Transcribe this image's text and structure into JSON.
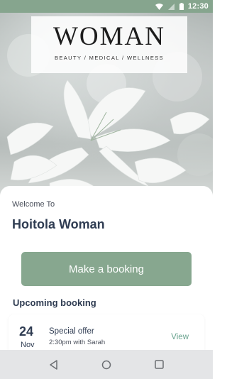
{
  "status_bar": {
    "time": "12:30",
    "icons": [
      "wifi-icon",
      "signal-icon",
      "battery-icon"
    ]
  },
  "hero": {
    "logo": {
      "word": "WOMAN",
      "tagline": "BEAUTY  /  MEDICAL  /  WELLNESS"
    }
  },
  "welcome": {
    "greeting": "Welcome To",
    "title": "Hoitola Woman"
  },
  "actions": {
    "booking_label": "Make a booking"
  },
  "upcoming": {
    "heading": "Upcoming booking",
    "items": [
      {
        "day": "24",
        "month": "Nov",
        "title": "Special offer",
        "details": "2:30pm with Sarah",
        "action": "View"
      }
    ]
  },
  "nav": {
    "buttons": [
      "back-icon",
      "home-icon",
      "recents-icon"
    ]
  },
  "colors": {
    "accent": "#87a78f",
    "status_bar": "#86a58e",
    "title_text": "#2f3c52",
    "link": "#6aa38f"
  }
}
